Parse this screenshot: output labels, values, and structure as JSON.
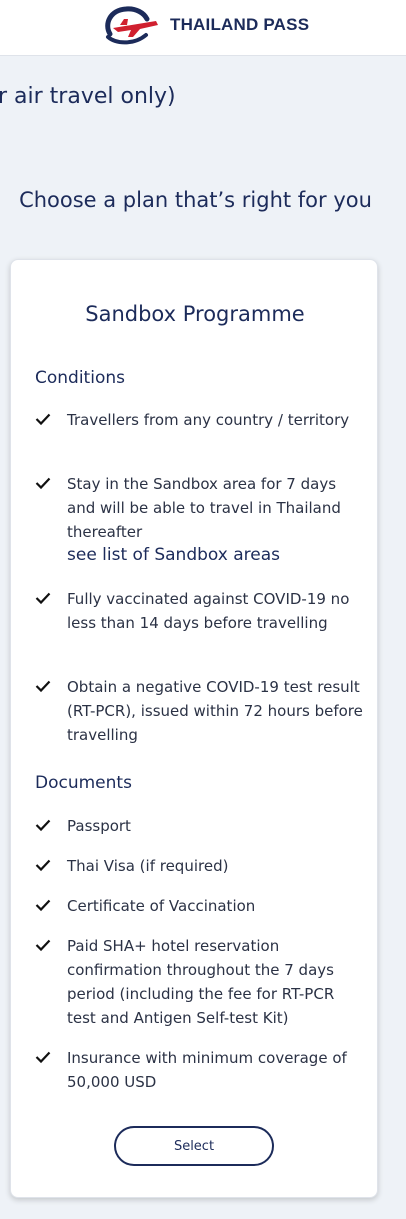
{
  "header": {
    "brand": "THAILAND PASS",
    "logo_icon": "plane-logo-icon"
  },
  "partial_heading": "r air travel only)",
  "plan_heading": "Choose a plan that’s right for you",
  "card": {
    "title": "Sandbox Programme",
    "conditions_title": "Conditions",
    "conditions": [
      {
        "text": "Travellers from any country / territory"
      },
      {
        "text": "Stay in the Sandbox area for 7 days and will be able to travel in Thailand thereafter",
        "link": "see list of Sandbox areas"
      },
      {
        "text": "Fully vaccinated against COVID-19 no less than 14 days before travelling"
      },
      {
        "text": "Obtain a negative COVID-19 test result (RT-PCR), issued within 72 hours before travelling"
      }
    ],
    "documents_title": "Documents",
    "documents": [
      {
        "text": "Passport"
      },
      {
        "text": "Thai Visa (if required)"
      },
      {
        "text": "Certificate of Vaccination"
      },
      {
        "text": "Paid SHA+ hotel reservation confirmation throughout the 7 days period (including the fee for RT-PCR test and Antigen Self-test Kit)"
      },
      {
        "text": "Insurance with minimum coverage of 50,000 USD"
      }
    ],
    "select_label": "Select"
  },
  "colors": {
    "primary": "#1c2b5a",
    "accent_red": "#d0202f",
    "background": "#eef2f7"
  }
}
